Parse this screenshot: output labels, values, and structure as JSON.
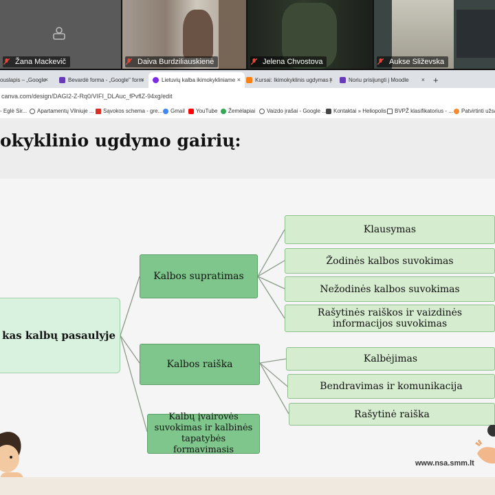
{
  "participants": [
    {
      "name": "Žana Mackevič"
    },
    {
      "name": "Daiva Burdziliauskienė"
    },
    {
      "name": "Jelena Chvostova"
    },
    {
      "name": "Aukse Sliževska"
    }
  ],
  "browser": {
    "tabs": [
      {
        "label": "ouslapis – „Google"
      },
      {
        "label": "Bevardė forma - „Google\" form"
      },
      {
        "label": "Lietuvių kalba ikimokykliniame"
      },
      {
        "label": "Kursai: Ikimokyklinis ugdymas |"
      },
      {
        "label": "Noriu prisijungti į Moodle"
      }
    ],
    "new_tab": "+",
    "close_glyph": "×",
    "url": "canva.com/design/DAGI2-Z-Rq0/VIFI_DLAuc_fPvflZ-94xg/edit",
    "bookmarks": [
      {
        "label": "- Eglė Sir..."
      },
      {
        "label": "Apartamentų Vilniuje ..."
      },
      {
        "label": "Sąvokos schema - gre..."
      },
      {
        "label": "Gmail"
      },
      {
        "label": "YouTube"
      },
      {
        "label": "Žemėlapiai"
      },
      {
        "label": "Vaizdo įrašai - Google ..."
      },
      {
        "label": "Kontaktai » Heliopolis"
      },
      {
        "label": "BVPŽ klasifikatorius - ..."
      },
      {
        "label": "Patvirtinti užsak"
      }
    ]
  },
  "slide": {
    "title": "okyklinio ugdymo gairių:",
    "root": "kas kalbų pasaulyje",
    "branches": [
      {
        "label": "Kalbos supratimas"
      },
      {
        "label": "Kalbos raiška"
      },
      {
        "label": "Kalbų įvairovės suvokimas ir kalbinės tapatybės formavimasis"
      }
    ],
    "leaves": [
      {
        "label": "Klausymas"
      },
      {
        "label": "Žodinės kalbos suvokimas"
      },
      {
        "label": "Nežodinės kalbos suvokimas"
      },
      {
        "label": "Rašytinės raiškos ir vaizdinės informacijos suvokimas"
      },
      {
        "label": "Kalbėjimas"
      },
      {
        "label": "Bendravimas ir komunikacija"
      },
      {
        "label": "Rašytinė raiška"
      }
    ],
    "footer": "www.nsa.smm.lt"
  }
}
